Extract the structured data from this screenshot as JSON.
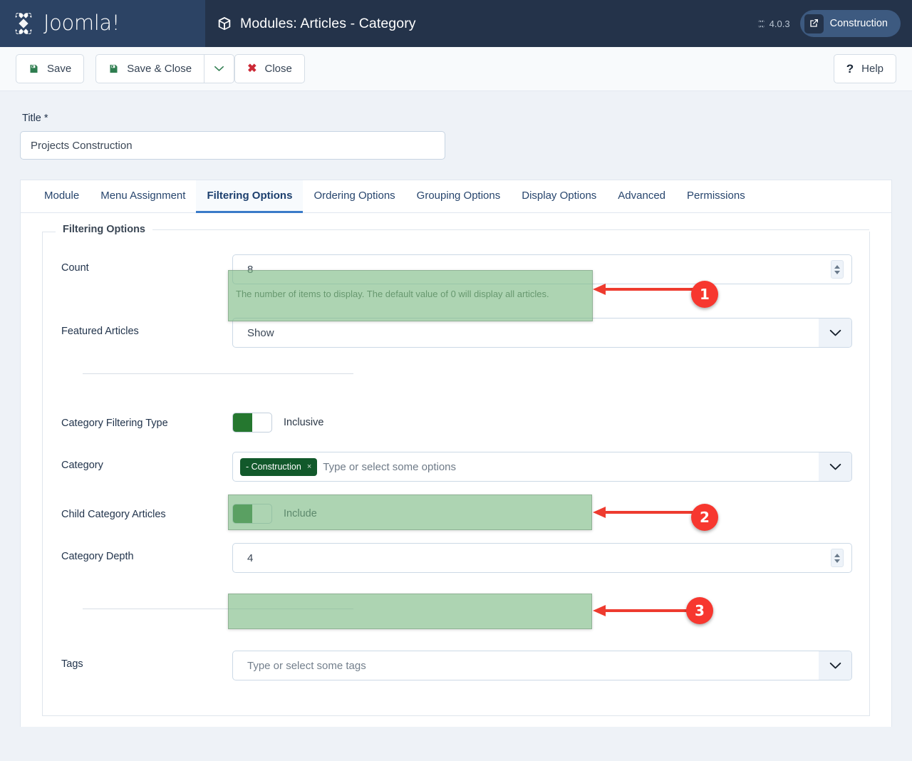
{
  "header": {
    "brand_name": "Joomla!",
    "page_title": "Modules: Articles - Category",
    "version": "4.0.3",
    "site_label": "Construction"
  },
  "toolbar": {
    "save_label": "Save",
    "save_close_label": "Save & Close",
    "close_label": "Close",
    "help_label": "Help"
  },
  "form": {
    "title_label": "Title *",
    "title_value": "Projects Construction"
  },
  "tabs": [
    {
      "label": "Module",
      "active": false
    },
    {
      "label": "Menu Assignment",
      "active": false
    },
    {
      "label": "Filtering Options",
      "active": true
    },
    {
      "label": "Ordering Options",
      "active": false
    },
    {
      "label": "Grouping Options",
      "active": false
    },
    {
      "label": "Display Options",
      "active": false
    },
    {
      "label": "Advanced",
      "active": false
    },
    {
      "label": "Permissions",
      "active": false
    }
  ],
  "fieldset": {
    "legend": "Filtering Options",
    "count": {
      "label": "Count",
      "value": "8",
      "help": "The number of items to display. The default value of 0 will display all articles."
    },
    "featured_articles": {
      "label": "Featured Articles",
      "value": "Show"
    },
    "category_filtering_type": {
      "label": "Category Filtering Type",
      "state_label": "Inclusive"
    },
    "category": {
      "label": "Category",
      "chip_label": "- Construction",
      "chip_remove": "×",
      "placeholder": "Type or select some options"
    },
    "child_category_articles": {
      "label": "Child Category Articles",
      "state_label": "Include"
    },
    "category_depth": {
      "label": "Category Depth",
      "value": "4"
    },
    "tags": {
      "label": "Tags",
      "placeholder": "Type or select some tags"
    }
  },
  "annotations": [
    {
      "number": "1"
    },
    {
      "number": "2"
    },
    {
      "number": "3"
    }
  ],
  "colors": {
    "header_bg": "#24334a",
    "brand_bg": "#2c4364",
    "accent_blue": "#3a7bc8",
    "toggle_green": "#25772f",
    "chip_green": "#12592b",
    "annotation_red": "#f7372f",
    "highlight_green": "#7aba82"
  }
}
